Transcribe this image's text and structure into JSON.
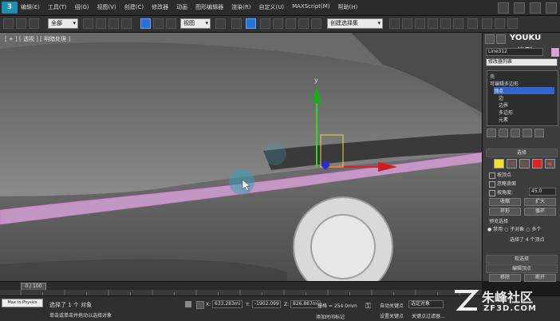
{
  "menubar": {
    "logo": "3",
    "items": [
      "编辑(E)",
      "工具(T)",
      "组(G)",
      "视图(V)",
      "创建(C)",
      "修改器",
      "动画",
      "图形编辑器",
      "渲染(R)",
      "自定义(U)",
      "MAXScript(M)",
      "帮助(H)"
    ]
  },
  "toolbar": {
    "filter_dropdown": "全部",
    "view_dropdown": "视图",
    "selection_set": "创建选择集"
  },
  "viewport": {
    "label": "[ + ] [ 透视 ] [ 明暗处理 ]",
    "gizmo_axis_y": "y"
  },
  "panel": {
    "youku": "YOUKU",
    "youku_sub": "优酷",
    "object_name": "Line312",
    "modifier_list": "修改器列表",
    "stack": {
      "top": "壳",
      "item1": "可编辑多边形",
      "selected": "顶点",
      "sub": [
        "边",
        "边界",
        "多边形",
        "元素"
      ]
    },
    "selection": {
      "title": "选择",
      "by_vertex": "按顶点",
      "ignore_backface": "忽略背面",
      "by_angle": "按角度:",
      "angle_value": "45.0",
      "shrink": "收缩",
      "grow": "扩大",
      "ring": "环形",
      "loop": "循环",
      "preview_title": "预览选择",
      "disable": "禁用",
      "subobject": "子对象",
      "multi": "多个",
      "selected_info": "选择了 4 个顶点"
    },
    "soft_selection": "软选择",
    "edit_vertices": "编辑顶点",
    "remove": "移除",
    "break": "断开"
  },
  "timeline": {
    "frame": "0 / 100"
  },
  "status": {
    "maxscript_label": "Max to Physics",
    "selected_text": "选择了 1 个 对象",
    "prompt_text": "单击或单击并拖动以选择对象",
    "x_label": "X:",
    "x_value": "633.283mi",
    "y_label": "Y:",
    "y_value": "-1902.099",
    "z_label": "Z:",
    "z_value": "826.887mi",
    "grid": "栅格 = 254.0mm",
    "add_time_tag": "添加时间标记",
    "auto_key": "自动关键点",
    "selected_obj": "选定对象",
    "set_key": "设置关键点",
    "key_filters": "关键点过滤器..."
  },
  "watermark": {
    "brand": "朱峰社区",
    "url": "ZF3D.COM"
  }
}
